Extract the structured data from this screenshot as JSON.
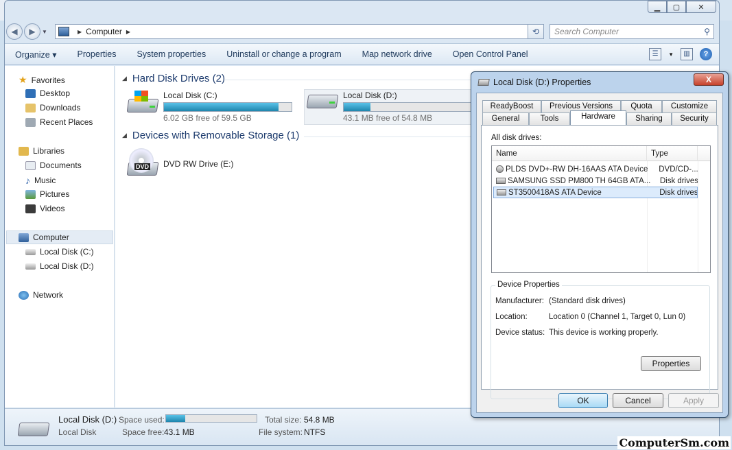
{
  "window": {
    "address": {
      "location": "Computer"
    },
    "search": {
      "placeholder": "Search Computer"
    }
  },
  "toolbar": {
    "items": [
      "Organize",
      "Properties",
      "System properties",
      "Uninstall or change a program",
      "Map network drive",
      "Open Control Panel"
    ]
  },
  "nav": {
    "favorites": "Favorites",
    "desktop": "Desktop",
    "downloads": "Downloads",
    "recent": "Recent Places",
    "libraries": "Libraries",
    "documents": "Documents",
    "music": "Music",
    "pictures": "Pictures",
    "videos": "Videos",
    "computer": "Computer",
    "disk_c": "Local Disk (C:)",
    "disk_d": "Local Disk (D:)",
    "network": "Network"
  },
  "content": {
    "hdd_group": "Hard Disk Drives (2)",
    "removable_group": "Devices with Removable Storage (1)",
    "drive_c": {
      "name": "Local Disk (C:)",
      "free": "6.02 GB free of 59.5 GB",
      "used_fraction": 0.9
    },
    "drive_d": {
      "name": "Local Disk (D:)",
      "free": "43.1 MB free of 54.8 MB",
      "used_fraction": 0.21
    },
    "dvd": {
      "name": "DVD RW Drive (E:)",
      "icon_label": "DVD"
    }
  },
  "details": {
    "name": "Local Disk (D:)",
    "type": "Local Disk",
    "space_used_label": "Space used:",
    "space_free_label": "Space free:",
    "space_free": "43.1 MB",
    "total_size_label": "Total size:",
    "total_size": "54.8 MB",
    "fs_label": "File system:",
    "fs": "NTFS",
    "used_fraction": 0.21
  },
  "dialog": {
    "title": "Local Disk (D:) Properties",
    "close": "X",
    "tabs_row1": [
      "ReadyBoost",
      "Previous Versions",
      "Quota",
      "Customize"
    ],
    "tabs_row2": [
      "General",
      "Tools",
      "Hardware",
      "Sharing",
      "Security"
    ],
    "active_tab": "Hardware",
    "all_disk_drives": "All disk drives:",
    "col_name": "Name",
    "col_type": "Type",
    "drives": [
      {
        "name": "PLDS DVD+-RW DH-16AAS ATA Device",
        "type": "DVD/CD-..."
      },
      {
        "name": "SAMSUNG SSD PM800 TH 64GB ATA...",
        "type": "Disk drives"
      },
      {
        "name": "ST3500418AS ATA Device",
        "type": "Disk drives"
      }
    ],
    "device_properties": "Device Properties",
    "manufacturer_label": "Manufacturer:",
    "manufacturer": "(Standard disk drives)",
    "location_label": "Location:",
    "location": "Location 0 (Channel 1, Target 0, Lun 0)",
    "status_label": "Device status:",
    "status": "This device is working properly.",
    "properties_btn": "Properties",
    "ok": "OK",
    "cancel": "Cancel",
    "apply": "Apply"
  },
  "watermark": "ComputerSm.com"
}
